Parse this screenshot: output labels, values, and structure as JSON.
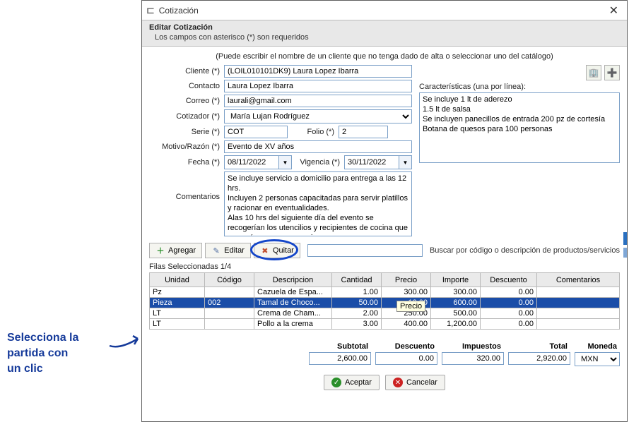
{
  "callout": {
    "line1": "Selecciona la",
    "line2": "partida con",
    "line3": "un clic"
  },
  "window": {
    "title": "Cotización",
    "edit_title": "Editar Cotización",
    "required_hint": "Los campos con asterisco (*) son requeridos",
    "catalog_hint": "(Puede escribir el nombre de un cliente que no tenga dado de alta o seleccionar uno del catálogo)"
  },
  "labels": {
    "cliente": "Cliente (*)",
    "contacto": "Contacto",
    "correo": "Correo (*)",
    "cotizador": "Cotizador (*)",
    "serie": "Serie (*)",
    "folio": "Folio (*)",
    "motivo": "Motivo/Razón (*)",
    "fecha": "Fecha (*)",
    "vigencia": "Vigencia (*)",
    "comentarios": "Comentarios",
    "caracteristicas": "Características (una por línea):"
  },
  "form": {
    "cliente": "(LOIL010101DK9) Laura Lopez Ibarra",
    "contacto": "Laura Lopez Ibarra",
    "correo": "laurali@gmail.com",
    "cotizador": "María Lujan Rodríguez",
    "serie": "COT",
    "folio": "2",
    "motivo": "Evento de XV años",
    "fecha": "08/11/2022",
    "vigencia": "30/11/2022",
    "comentarios": "Se incluye servicio a domicilio para entrega a las 12 hrs.\nIncluyen 2 personas capacitadas para servir platillos y racionar en eventualidades.\nAlas 10 hrs del siguiente día del evento se recogerían los utencilios y recipientes de cocina que se envían para su manejo\nNo se incluye losa para servir platillos.",
    "caracteristicas": "Se incluye 1 lt de aderezo\n1.5 lt de salsa\nSe incluyen panecillos de entrada 200 pz de cortesía\nBotana de quesos para 100 personas"
  },
  "toolbar": {
    "agregar": "Agregar",
    "editar": "Editar",
    "quitar": "Quitar",
    "buscar_hint": "Buscar por código o descripción de productos/servicios"
  },
  "grid": {
    "selected_info": "Filas Seleccionadas 1/4",
    "headers": {
      "unidad": "Unidad",
      "codigo": "Código",
      "descripcion": "Descripcion",
      "cantidad": "Cantidad",
      "precio": "Precio",
      "importe": "Importe",
      "descuento": "Descuento",
      "comentarios": "Comentarios"
    },
    "price_tooltip": "Precio",
    "rows": [
      {
        "unidad": "Pz",
        "codigo": "",
        "descripcion": "Cazuela de Espa...",
        "cantidad": "1.00",
        "precio": "300.00",
        "importe": "300.00",
        "descuento": "0.00",
        "comentarios": ""
      },
      {
        "unidad": "Pieza",
        "codigo": "002",
        "descripcion": "Tamal de Choco...",
        "cantidad": "50.00",
        "precio": "12.00",
        "importe": "600.00",
        "descuento": "0.00",
        "comentarios": "",
        "selected": true
      },
      {
        "unidad": "LT",
        "codigo": "",
        "descripcion": "Crema de Cham...",
        "cantidad": "2.00",
        "precio": "250.00",
        "importe": "500.00",
        "descuento": "0.00",
        "comentarios": ""
      },
      {
        "unidad": "LT",
        "codigo": "",
        "descripcion": "Pollo a la crema",
        "cantidad": "3.00",
        "precio": "400.00",
        "importe": "1,200.00",
        "descuento": "0.00",
        "comentarios": ""
      }
    ]
  },
  "totals": {
    "labels": {
      "subtotal": "Subtotal",
      "descuento": "Descuento",
      "impuestos": "Impuestos",
      "total": "Total",
      "moneda": "Moneda"
    },
    "subtotal": "2,600.00",
    "descuento": "0.00",
    "impuestos": "320.00",
    "total": "2,920.00",
    "moneda": "MXN"
  },
  "dialog": {
    "aceptar": "Aceptar",
    "cancelar": "Cancelar"
  }
}
